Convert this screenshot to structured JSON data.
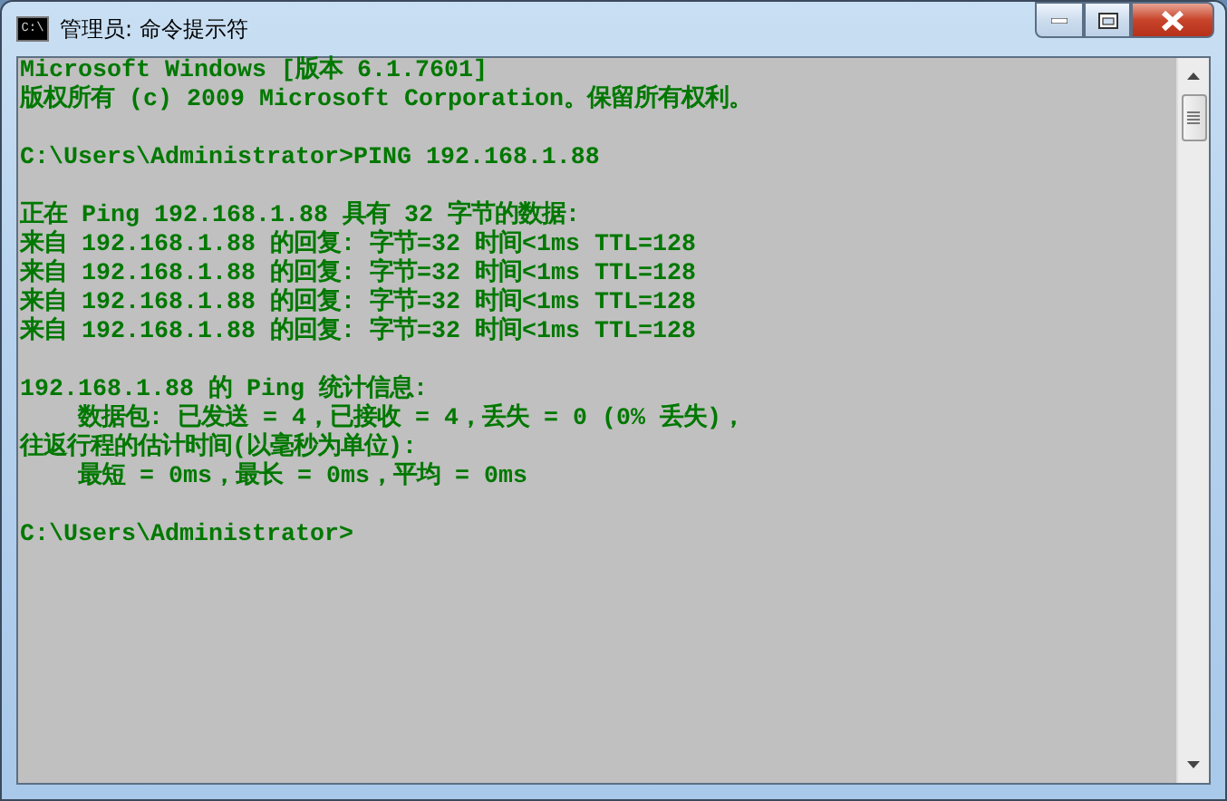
{
  "window": {
    "title": "管理员: 命令提示符",
    "icon_text": "C:\\"
  },
  "console": {
    "blocks": [
      {
        "lines": [
          {
            "text": "Microsoft Windows [版本 6.1.7601]",
            "indented": false
          },
          {
            "text": "版权所有 (c) 2009 Microsoft Corporation。保留所有权利。",
            "indented": false
          }
        ]
      },
      {
        "lines": [
          {
            "text": "C:\\Users\\Administrator>PING 192.168.1.88",
            "indented": false
          }
        ]
      },
      {
        "lines": [
          {
            "text": "正在 Ping 192.168.1.88 具有 32 字节的数据:",
            "indented": false
          },
          {
            "text": "来自 192.168.1.88 的回复: 字节=32 时间<1ms TTL=128",
            "indented": false
          },
          {
            "text": "来自 192.168.1.88 的回复: 字节=32 时间<1ms TTL=128",
            "indented": false
          },
          {
            "text": "来自 192.168.1.88 的回复: 字节=32 时间<1ms TTL=128",
            "indented": false
          },
          {
            "text": "来自 192.168.1.88 的回复: 字节=32 时间<1ms TTL=128",
            "indented": false
          }
        ]
      },
      {
        "lines": [
          {
            "text": "192.168.1.88 的 Ping 统计信息:",
            "indented": false
          },
          {
            "text": "数据包: 已发送 = 4，已接收 = 4，丢失 = 0 (0% 丢失)，",
            "indented": true
          },
          {
            "text": "往返行程的估计时间(以毫秒为单位):",
            "indented": false
          },
          {
            "text": "最短 = 0ms，最长 = 0ms，平均 = 0ms",
            "indented": true
          }
        ]
      },
      {
        "lines": [
          {
            "text": "C:\\Users\\Administrator>",
            "indented": false
          }
        ]
      }
    ]
  }
}
